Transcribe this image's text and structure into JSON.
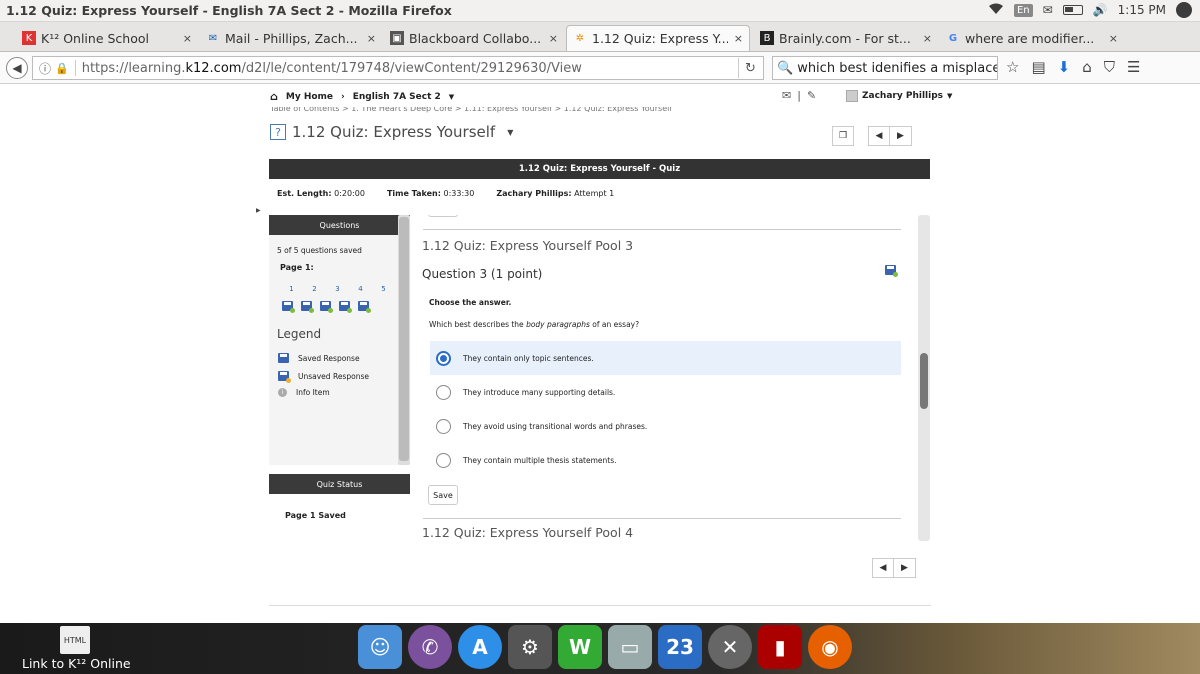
{
  "window": {
    "title": "1.12 Quiz: Express Yourself - English 7A Sect 2 - Mozilla Firefox",
    "time": "1:15 PM",
    "lang": "En"
  },
  "tabs": [
    {
      "label": "K¹² Online School",
      "close": "×"
    },
    {
      "label": "Mail - Phillips, Zach...",
      "close": "×"
    },
    {
      "label": "Blackboard Collabo...",
      "close": "×"
    },
    {
      "label": "1.12 Quiz: Express Y...",
      "close": "×"
    },
    {
      "label": "Brainly.com - For st...",
      "close": "×"
    },
    {
      "label": "where are modifier...",
      "close": "×"
    }
  ],
  "new_tab": "+",
  "nav": {
    "url_prefix": "https://learning.",
    "url_domain": "k12.com",
    "url_suffix": "/d2l/le/content/179748/viewContent/29129630/View",
    "search_value": "which best idenifies a misplaced"
  },
  "d2l": {
    "home": "My Home",
    "course": "English 7A Sect 2",
    "user": "Zachary Phillips",
    "breadcrumb": "Table of Contents  >  1. The Heart's Deep Core  >  1.11: Express Yourself  >  1.12 Quiz: Express Yourself"
  },
  "page": {
    "title": "1.12 Quiz: Express Yourself",
    "quiz_header": "1.12 Quiz: Express Yourself - Quiz",
    "est_label": "Est. Length:",
    "est_value": "0:20:00",
    "taken_label": "Time Taken:",
    "taken_value": "0:33:30",
    "attempt_user": "Zachary Phillips:",
    "attempt": "Attempt 1"
  },
  "sidebar": {
    "header": "Questions",
    "saved": "5 of 5 questions saved",
    "page_label": "Page 1:",
    "numbers": [
      "1",
      "2",
      "3",
      "4",
      "5"
    ],
    "legend_title": "Legend",
    "legend": [
      {
        "label": "Saved Response",
        "icon": "saved-disk-icon"
      },
      {
        "label": "Unsaved Response",
        "icon": "unsaved-disk-icon"
      },
      {
        "label": "Info Item",
        "icon": "info-icon"
      }
    ],
    "status_header": "Quiz Status",
    "status_text": "Page 1 Saved"
  },
  "question": {
    "pool": "1.12 Quiz: Express Yourself Pool 3",
    "number": "Question 3 (1 point)",
    "instruction": "Choose the answer.",
    "prompt_before": "Which best describes the ",
    "prompt_italic": "body paragraphs",
    "prompt_after": " of an essay?",
    "options": [
      {
        "text": "They contain only topic sentences.",
        "selected": true
      },
      {
        "text": "They introduce many supporting details.",
        "selected": false
      },
      {
        "text": "They avoid using transitional words and phrases.",
        "selected": false
      },
      {
        "text": "They contain multiple thesis statements.",
        "selected": false
      }
    ],
    "save_label": "Save",
    "next_pool": "1.12 Quiz: Express Yourself Pool 4"
  },
  "desktop": {
    "icon_text": "HTML",
    "label": "Link to K¹² Online",
    "calendar_day": "23"
  },
  "colors": {
    "accent": "#2b6cc4",
    "header_dark": "#333333"
  }
}
